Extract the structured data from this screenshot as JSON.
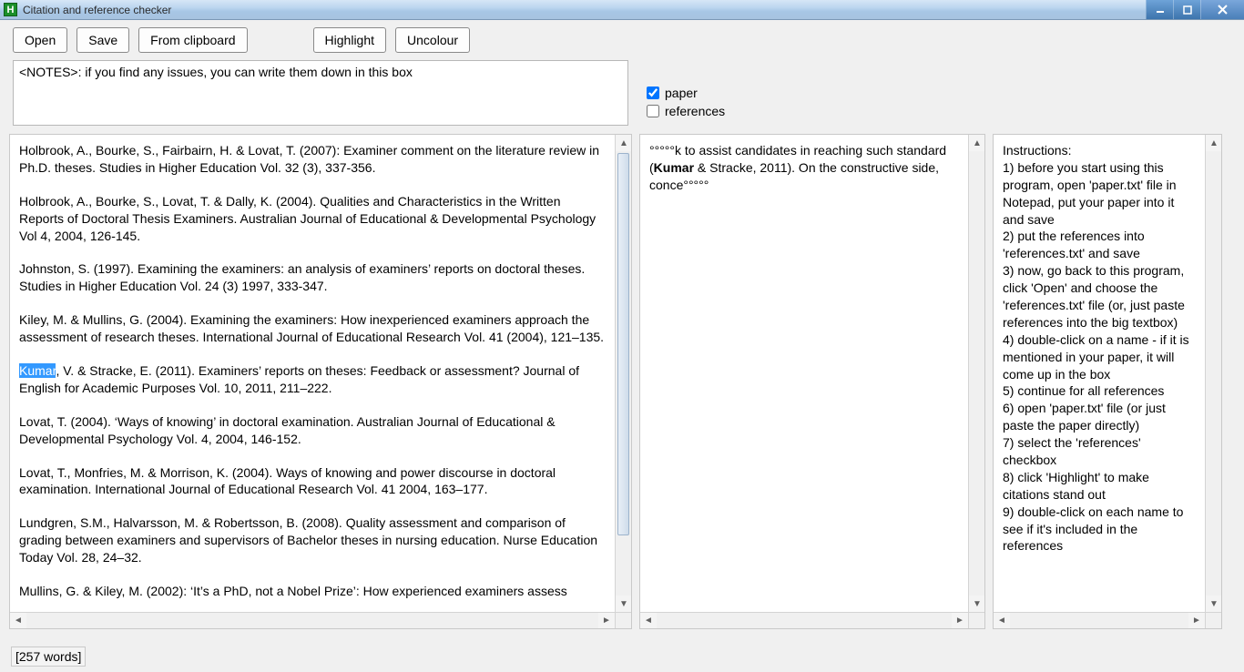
{
  "titlebar": {
    "title": "Citation and reference checker",
    "icon_letter": "H"
  },
  "toolbar": {
    "open": "Open",
    "save": "Save",
    "from_clipboard": "From clipboard",
    "highlight": "Highlight",
    "uncolour": "Uncolour"
  },
  "notes": {
    "text": "<NOTES>: if you find any issues, you can write them down in this box"
  },
  "checks": {
    "paper_label": "paper",
    "references_label": "references",
    "paper_checked": true,
    "references_checked": false
  },
  "selection": {
    "highlighted_word": "Kumar"
  },
  "references": [
    "Holbrook, A., Bourke, S., Fairbairn, H. & Lovat, T. (2007): Examiner comment on the literature review in Ph.D. theses. Studies in Higher Education Vol. 32 (3), 337-356.",
    "Holbrook, A., Bourke, S., Lovat, T. & Dally, K. (2004). Qualities and Characteristics in the Written Reports of Doctoral Thesis Examiners. Australian Journal of Educational & Developmental Psychology Vol 4, 2004, 126-145.",
    "Johnston, S. (1997). Examining the examiners: an analysis of examiners’ reports on doctoral theses. Studies in Higher Education Vol. 24 (3) 1997, 333-347.",
    "Kiley, M. & Mullins, G. (2004). Examining the examiners: How inexperienced examiners approach the assessment of research theses. International Journal of Educational Research Vol. 41 (2004), 121–135.",
    "Kumar, V. & Stracke, E. (2011). Examiners’ reports on theses: Feedback or assessment? Journal of English for Academic Purposes Vol. 10, 2011, 211–222.",
    "Lovat, T. (2004). ‘Ways of knowing’ in doctoral examination. Australian Journal of Educational & Developmental Psychology Vol. 4, 2004, 146-152.",
    "Lovat, T., Monfries, M. & Morrison, K. (2004). Ways of knowing and power discourse in doctoral examination. International Journal of Educational Research Vol. 41 2004, 163–177.",
    "Lundgren, S.M., Halvarsson, M. & Robertsson, B. (2008). Quality assessment and comparison of grading between examiners and supervisors of Bachelor theses in nursing education. Nurse Education Today Vol. 28, 24–32.",
    "Mullins, G. & Kiley, M. (2002): ‘It’s a PhD, not a Nobel Prize’: How experienced examiners assess"
  ],
  "paper_excerpt": {
    "prefix": "°°°°°k to assist candidates in reaching such standard (",
    "bold": "Kumar",
    "middle": " & Stracke, 2011). On the constructive side, conce°°°°°"
  },
  "instructions": {
    "heading": "Instructions:",
    "lines": [
      "1) before you start using this program, open 'paper.txt' file in Notepad, put your paper into it and save",
      "2) put the references into 'references.txt' and save",
      "3) now, go back to this program, click 'Open' and choose the 'references.txt' file (or, just paste references into the big textbox)",
      "4) double-click on a name - if it is mentioned in your paper, it will come up in the box",
      "5) continue for all references",
      "6) open 'paper.txt' file (or just paste the paper directly)",
      "7) select the 'references' checkbox",
      "8) click 'Highlight' to make citations stand out",
      "9) double-click on each name to see if it's included in the references"
    ]
  },
  "status": {
    "text": "[257 words]"
  }
}
